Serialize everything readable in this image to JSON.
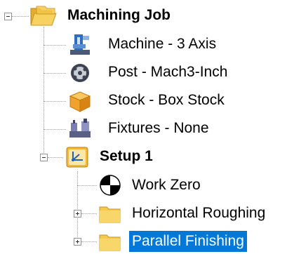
{
  "tree": {
    "root": {
      "label": "Machining Job"
    },
    "machine": {
      "label": "Machine - 3 Axis"
    },
    "post": {
      "label": "Post - Mach3-Inch"
    },
    "stock": {
      "label": "Stock - Box Stock"
    },
    "fixtures": {
      "label": "Fixtures - None"
    },
    "setup": {
      "label": "Setup 1",
      "children": [
        {
          "label": "Work Zero"
        },
        {
          "label": "Horizontal Roughing"
        },
        {
          "label": "Parallel Finishing",
          "selected": true
        }
      ]
    }
  },
  "colors": {
    "selection": "#0078d7",
    "folder": "#f5c94a",
    "stock": "#f0a22a"
  }
}
